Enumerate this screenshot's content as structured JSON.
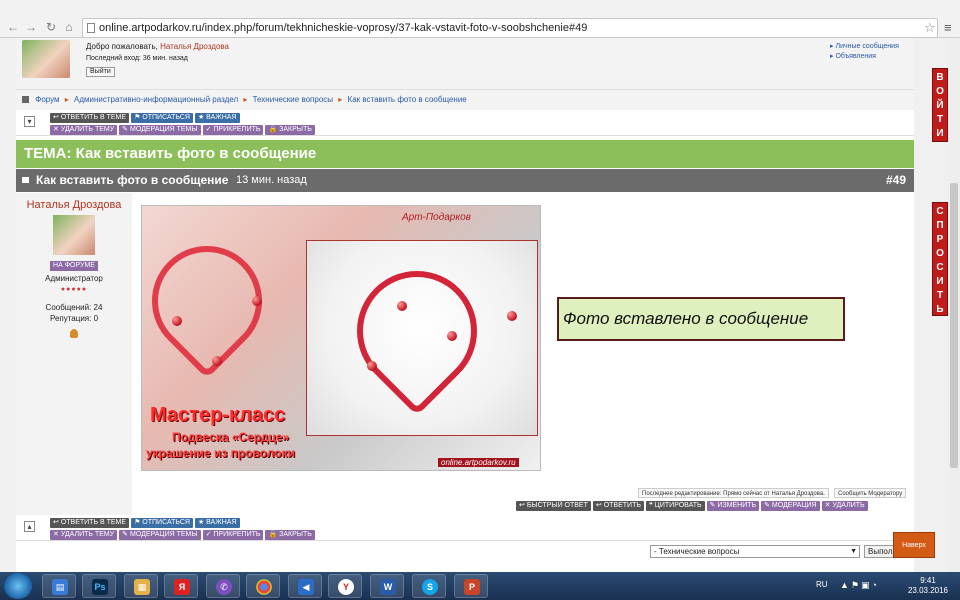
{
  "browser": {
    "url": "online.artpodarkov.ru/index.php/forum/tekhnicheskie-voprosy/37-kak-vstavit-foto-v-soobshchenie#49"
  },
  "userbox": {
    "welcome_prefix": "Добро пожаловать,",
    "username": "Наталья Дроздова",
    "last_visit": "Последний вход: 36 мин. назад",
    "logout": "Выйти",
    "links": [
      "Личные сообщения",
      "Объявления"
    ]
  },
  "breadcrumb": [
    "Форум",
    "Административно-информационный раздел",
    "Технические вопросы",
    "Как вставить фото в сообщение"
  ],
  "topic_buttons_row1": [
    "ОТВЕТИТЬ В ТЕМЕ",
    "ОТПИСАТЬСЯ",
    "ВАЖНАЯ"
  ],
  "topic_buttons_row2": [
    "УДАЛИТЬ ТЕМУ",
    "МОДЕРАЦИЯ ТЕМЫ",
    "ПРИКРЕПИТЬ",
    "ЗАКРЫТЬ"
  ],
  "topic_title": "ТЕМА: Как вставить фото в сообщение",
  "post": {
    "title": "Как вставить фото в сообщение",
    "time": "13 мин. назад",
    "number": "#49",
    "author": "Наталья Дроздова",
    "online_badge": "НА ФОРУМЕ",
    "role": "Администратор",
    "rank_dots": "●●●●●",
    "messages": "Сообщений: 24",
    "reputation": "Репутация: 0",
    "image": {
      "signature": "Арт-Подарков",
      "line1": "Мастер-класс",
      "line2": "Подвеска «Сердце»",
      "line3": "украшение из проволоки",
      "site": "online.artpodarkov.ru"
    },
    "callout": "Фото вставлено в сообщение",
    "last_edit": "Последнее редактирование: Прямо сейчас от Наталья Дроздова.",
    "report": "Сообщить Модератору",
    "actions": [
      "БЫСТРЫЙ ОТВЕТ",
      "ОТВЕТИТЬ",
      "ЦИТИРОВАТЬ",
      "ИЗМЕНИТЬ",
      "МОДЕРАЦИЯ",
      "УДАЛИТЬ"
    ]
  },
  "jump": {
    "selected": "- Технические вопросы",
    "go": "Выполнить"
  },
  "side_tabs": {
    "login": "ВОЙТИ",
    "ask": "СПРОСИТЬ"
  },
  "back_to_top": "Наверх",
  "taskbar": {
    "lang": "RU",
    "time": "9:41",
    "date": "23.03.2016",
    "apps": [
      "explorer",
      "photoshop",
      "file-manager",
      "yandex",
      "viber",
      "chrome",
      "audio",
      "yandex-browser",
      "word",
      "skype",
      "powerpoint"
    ]
  },
  "colors": {
    "topic_bar": "#8cbf5a",
    "post_header": "#6b6b6b",
    "side_tab": "#c01b1b",
    "back_button": "#d45b16"
  }
}
